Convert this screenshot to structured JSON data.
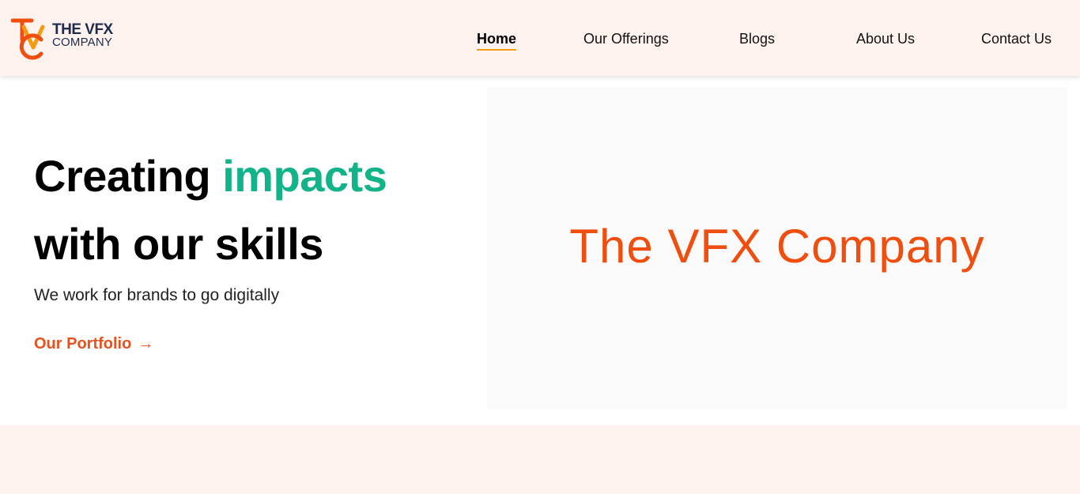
{
  "brand": {
    "logo_line1": "THE VFX",
    "logo_line2": "COMPANY",
    "logo_icon": "tvc-monogram",
    "accent_orange": "#f04e0e",
    "accent_green": "#13b38a",
    "nav_bg": "#fdf2ee"
  },
  "nav": {
    "items": [
      {
        "label": "Home",
        "active": true
      },
      {
        "label": "Our Offerings",
        "active": false
      },
      {
        "label": "Blogs",
        "active": false
      },
      {
        "label": "About Us",
        "active": false
      },
      {
        "label": "Contact Us",
        "active": false
      }
    ]
  },
  "hero": {
    "title_part1": "Creating ",
    "title_accent": "impacts",
    "title_line2": "with our skills",
    "subtitle": "We work for brands to go digitally",
    "cta_label": "Our Portfolio",
    "cta_icon": "→",
    "panel_text": "The VFX Company"
  }
}
